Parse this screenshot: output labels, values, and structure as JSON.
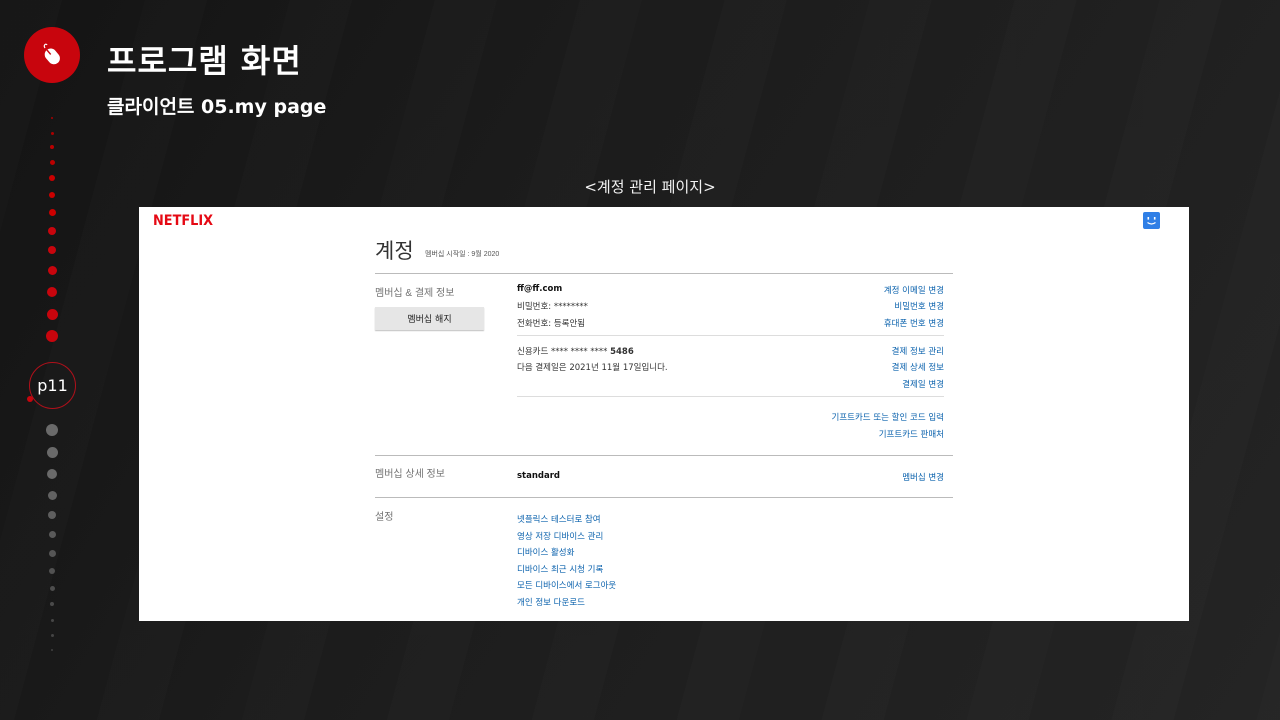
{
  "slide": {
    "title": "프로그램 화면",
    "subtitle": "클라이언트 05.my page",
    "page_number": "p11",
    "caption": "<계정 관리 페이지>",
    "logo_icon": "mouse-icon",
    "accent_color": "#c8050d"
  },
  "screenshot": {
    "brand": "NETFLIX",
    "avatar_icon": "smiley-avatar-icon",
    "account_title": "계정",
    "member_since": "멤버십 시작일 : 9월 2020",
    "membership_billing": {
      "label": "멤버십 & 결제 정보",
      "cancel_button": "멤버십 해지",
      "email": "ff@ff.com",
      "password": "비밀번호: ********",
      "phone": "전화번호: 등록안됨",
      "change_email": "계정 이메일 변경",
      "change_password": "비밀번호 변경",
      "change_phone": "휴대폰 번호 변경",
      "card_prefix": "신용카드 **** **** ****",
      "card_last4": "5486",
      "next_billing": "다음 결제일은 2021년 11월 17일입니다.",
      "manage_payment": "결제 정보 관리",
      "billing_details": "결제 상세 정보",
      "change_billing_date": "결제일 변경",
      "redeem_gift": "기프트카드 또는 할인 코드 입력",
      "gift_retailers": "기프트카드 판매처"
    },
    "plan": {
      "label": "멤버십 상세 정보",
      "plan_name": "standard",
      "change_plan": "멤버십 변경"
    },
    "settings": {
      "label": "설정",
      "links": [
        "넷플릭스 테스터로 참여",
        "영상 저장 디바이스 관리",
        "디바이스 활성화",
        "디바이스 최근 시청 기록",
        "모든 디바이스에서 로그아웃",
        "개인 정보 다운로드"
      ]
    }
  }
}
